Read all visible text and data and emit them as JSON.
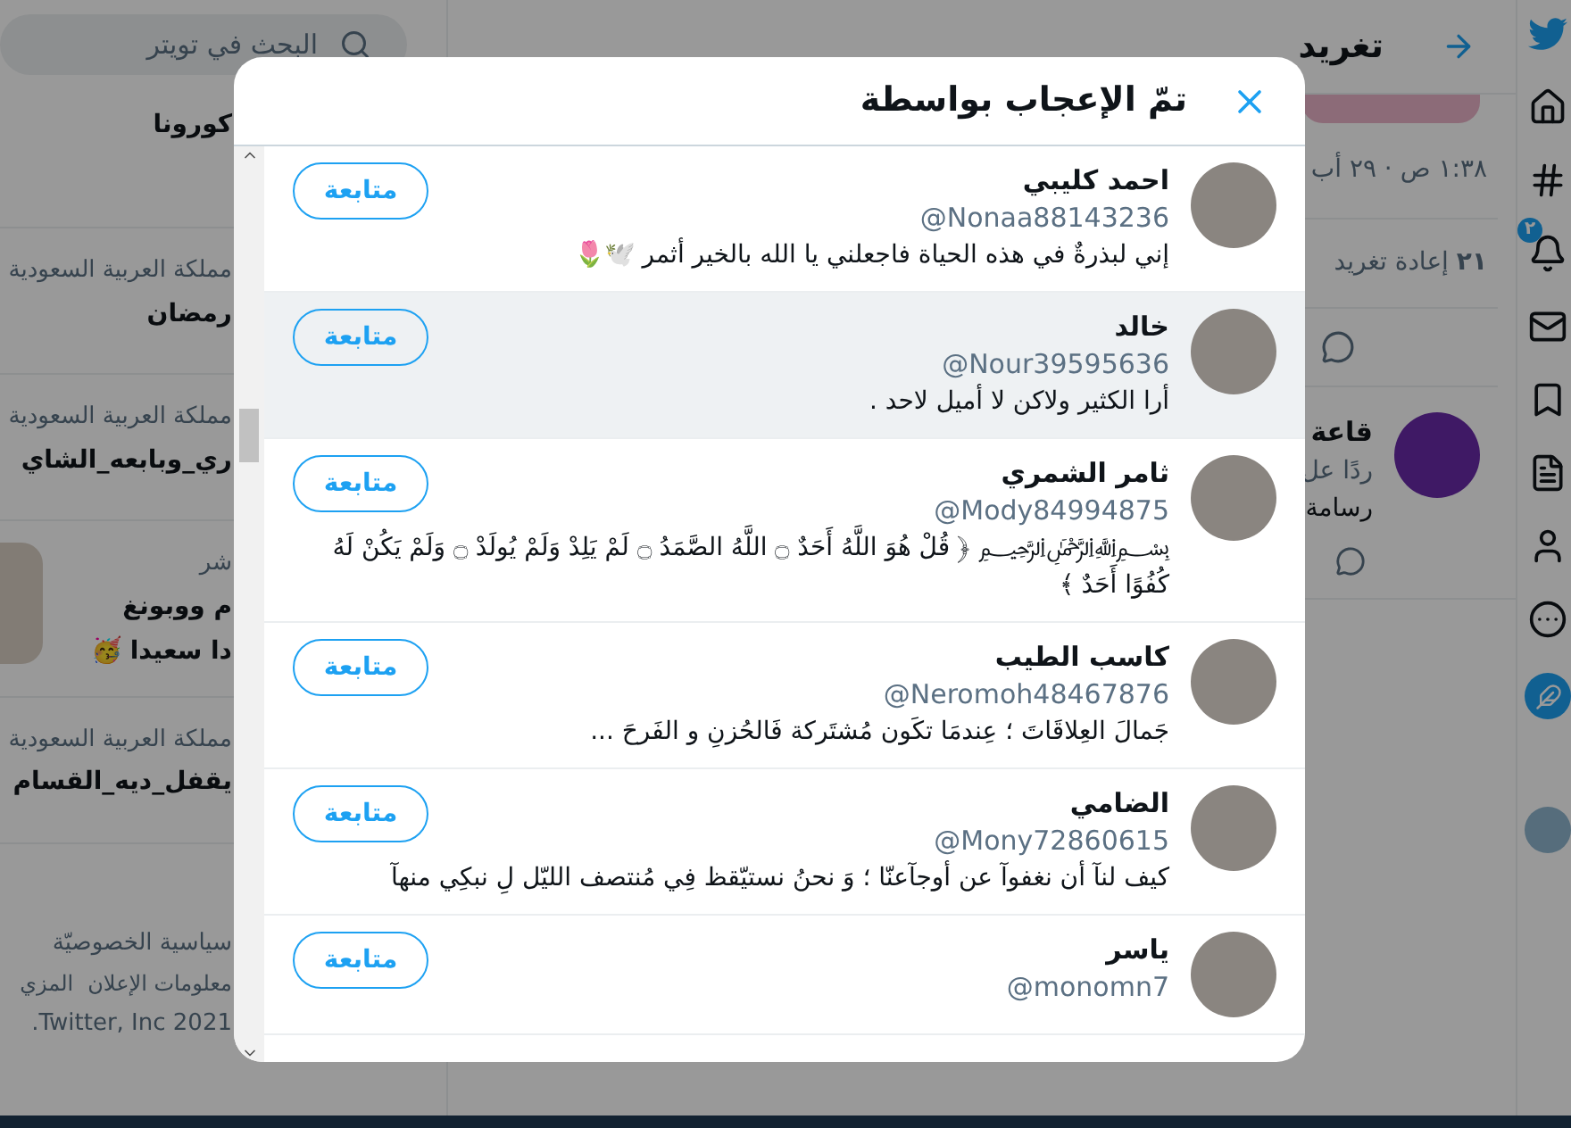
{
  "sidebar": {
    "search": {
      "placeholder": "البحث في تويتر"
    },
    "trends": [
      {
        "lines": [
          "كورونا"
        ],
        "thumbnail": false
      },
      {
        "context": "مملكة العربية السعودية",
        "lines": [
          "رمضان"
        ],
        "thumbnail": false
      },
      {
        "context": "مملكة العربية السعودية",
        "lines": [
          "ري_وبابعه_الشاي"
        ],
        "thumbnail": false
      },
      {
        "context": "شر",
        "lines": [
          "م ووبونغ",
          "دا سعيدا 🥳"
        ],
        "thumbnail": true
      },
      {
        "context": "مملكة العربية السعودية",
        "lines": [
          "يقفل_ديه_القسام"
        ],
        "thumbnail": false
      }
    ],
    "footer_links": [
      "سياسية الخصوصيّة",
      "معلومات الإعلان",
      "المزي"
    ],
    "copyright": ".Twitter, Inc 2021"
  },
  "tweet": {
    "header_title": "تغريد",
    "timestamp": "١:٣٨ ص · ٢٩ أب",
    "retweets": "**٢١** إعادة تغريد",
    "reply": {
      "name": "قاعة",
      "reply_to": "ردًا عل",
      "text": "رسامة"
    }
  },
  "nav": {
    "notification_badge": "٢"
  },
  "modal": {
    "title": "تمّ الإعجاب بواسطة",
    "users": [
      {
        "name": "احمد كليبي",
        "handle": "@Nonaa88143236",
        "bio": "إني لبذرةٌ في هذه الحياة فاجعلني يا الله بالخير أثمر 🕊️🌷",
        "button": "متابعة",
        "highlighted": false
      },
      {
        "name": "خالد",
        "handle": "@Nour39595636",
        "bio": "أرا الكثير ولاكن لا أميل لاحد .",
        "button": "متابعة",
        "highlighted": true
      },
      {
        "name": "ثامر الشمري",
        "handle": "@Mody84994875",
        "bio": "﷽ ﴿ قُلْ هُوَ اللَّهُ أَحَدٌ ۝ اللَّهُ الصَّمَدُ ۝ لَمْ يَلِدْ وَلَمْ يُولَدْ ۝ وَلَمْ يَكُنْ لَهُ كُفُوًا أَحَدٌ ﴾",
        "button": "متابعة",
        "highlighted": false
      },
      {
        "name": "كاسب الطيب",
        "handle": "@Neromoh48467876",
        "bio": "جَمالَ العِلاقَاتَ ؛ عِندمَا تكَون مُشتَركة فَالحُزنِ و الفَرحَ ...",
        "button": "متابعة",
        "highlighted": false
      },
      {
        "name": "الضامي",
        "handle": "@Mony72860615",
        "bio": "كيف لنآ أن نغفوآ عن أوجآعنّا ؛ وَ نحنُ نستيّقظ فِي مُنتصف الليّل لِ نبكِي منهآ",
        "button": "متابعة",
        "highlighted": false
      },
      {
        "name": "ياسر",
        "handle": "@monomn7",
        "button": "متابعة",
        "highlighted": false
      }
    ]
  }
}
